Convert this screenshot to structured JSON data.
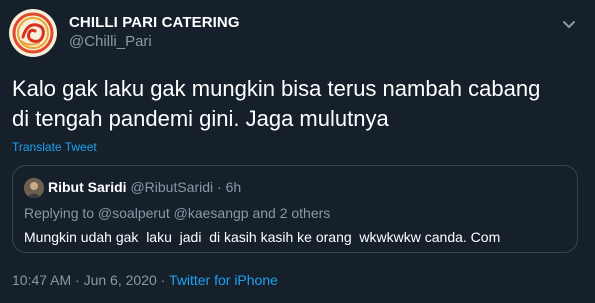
{
  "author": {
    "name": "CHILLI PARI CATERING",
    "handle": "@Chilli_Pari",
    "avatar_icon": "chilli-pari-logo-icon"
  },
  "menu_icon": "chevron-down-icon",
  "tweet": {
    "text_line1": "Kalo gak laku gak mungkin bisa terus nambah cabang",
    "text_line2": "di tengah pandemi gini. Jaga mulutnya",
    "translate_label": "Translate Tweet"
  },
  "quoted": {
    "name": "Ribut Saridi",
    "handle": "@RibutSaridi",
    "separator": "·",
    "time": "6h",
    "reply_context": "Replying to @soalperut @kaesangp and 2 others",
    "text": "Mungkin udah gak  laku  jadi  di kasih kasih ke orang  wkwkwkw canda. Com"
  },
  "meta": {
    "timestamp": "10:47 AM · Jun 6, 2020",
    "separator": "·",
    "source": "Twitter for iPhone"
  },
  "colors": {
    "background": "#15202b",
    "secondary_text": "#8899a6",
    "link": "#1da1f2",
    "border": "#38444d"
  }
}
